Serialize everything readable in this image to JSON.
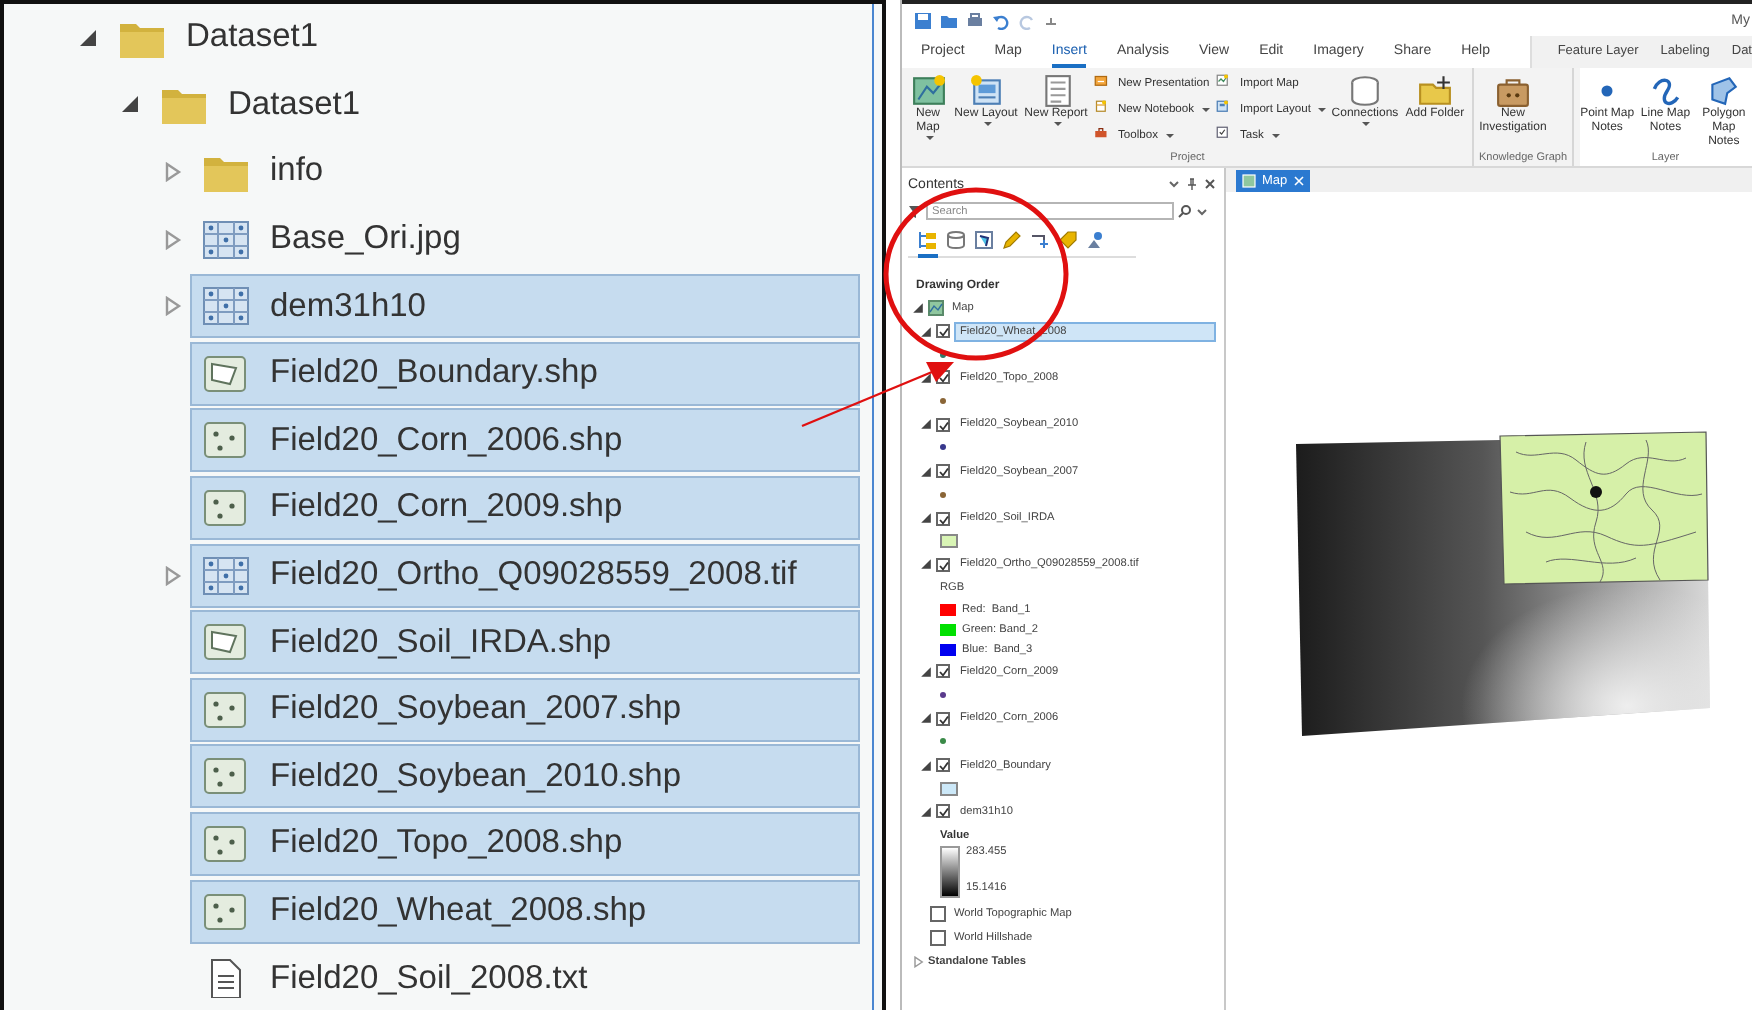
{
  "catalog": {
    "items": [
      {
        "name": "Dataset1",
        "kind": "folder",
        "expandable": true,
        "expanded": true,
        "selected": false,
        "children": [
          {
            "name": "Dataset1",
            "kind": "folder",
            "expandable": true,
            "expanded": true,
            "selected": false,
            "children": [
              {
                "name": "info",
                "kind": "folder",
                "expandable": true,
                "expanded": false,
                "selected": false
              },
              {
                "name": "Base_Ori.jpg",
                "kind": "raster",
                "expandable": true,
                "expanded": false,
                "selected": false
              },
              {
                "name": "dem31h10",
                "kind": "raster",
                "expandable": true,
                "expanded": false,
                "selected": true
              },
              {
                "name": "Field20_Boundary.shp",
                "kind": "polygon",
                "expandable": false,
                "expanded": false,
                "selected": true
              },
              {
                "name": "Field20_Corn_2006.shp",
                "kind": "point",
                "expandable": false,
                "expanded": false,
                "selected": true
              },
              {
                "name": "Field20_Corn_2009.shp",
                "kind": "point",
                "expandable": false,
                "expanded": false,
                "selected": true
              },
              {
                "name": "Field20_Ortho_Q09028559_2008.tif",
                "kind": "raster",
                "expandable": true,
                "expanded": false,
                "selected": true
              },
              {
                "name": "Field20_Soil_IRDA.shp",
                "kind": "polygon",
                "expandable": false,
                "expanded": false,
                "selected": true
              },
              {
                "name": "Field20_Soybean_2007.shp",
                "kind": "point",
                "expandable": false,
                "expanded": false,
                "selected": true
              },
              {
                "name": "Field20_Soybean_2010.shp",
                "kind": "point",
                "expandable": false,
                "expanded": false,
                "selected": true
              },
              {
                "name": "Field20_Topo_2008.shp",
                "kind": "point",
                "expandable": false,
                "expanded": false,
                "selected": true
              },
              {
                "name": "Field20_Wheat_2008.shp",
                "kind": "point",
                "expandable": false,
                "expanded": false,
                "selected": true
              },
              {
                "name": "Field20_Soil_2008.txt",
                "kind": "text",
                "expandable": false,
                "expanded": false,
                "selected": false
              }
            ]
          }
        ]
      }
    ]
  },
  "app": {
    "title_fragment": "My",
    "ribbon": {
      "tabs": [
        {
          "label": "Project",
          "selected": false
        },
        {
          "label": "Map",
          "selected": false
        },
        {
          "label": "Insert",
          "selected": true
        },
        {
          "label": "Analysis",
          "selected": false
        },
        {
          "label": "View",
          "selected": false
        },
        {
          "label": "Edit",
          "selected": false
        },
        {
          "label": "Imagery",
          "selected": false
        },
        {
          "label": "Share",
          "selected": false
        },
        {
          "label": "Help",
          "selected": false
        }
      ],
      "contextual_tabs": [
        {
          "label": "Feature Layer",
          "selected": false
        },
        {
          "label": "Labeling",
          "selected": false
        },
        {
          "label": "Dat",
          "selected": false
        }
      ],
      "groups": [
        {
          "label": "Project",
          "contextual": false,
          "items": [
            {
              "kind": "large",
              "label": "New Map",
              "dropdown": true
            },
            {
              "kind": "large",
              "label": "New Layout",
              "dropdown": true
            },
            {
              "kind": "large",
              "label": "New Report",
              "dropdown": true
            },
            {
              "kind": "stack",
              "buttons": [
                {
                  "label": "New Presentation",
                  "dropdown": false
                },
                {
                  "label": "New Notebook",
                  "dropdown": true
                },
                {
                  "label": "Toolbox",
                  "dropdown": true
                }
              ]
            },
            {
              "kind": "stack",
              "buttons": [
                {
                  "label": "Import Map",
                  "dropdown": false
                },
                {
                  "label": "Import Layout",
                  "dropdown": true
                },
                {
                  "label": "Task",
                  "dropdown": true
                }
              ]
            },
            {
              "kind": "large",
              "label": "Connections",
              "dropdown": true
            },
            {
              "kind": "large",
              "label": "Add Folder",
              "dropdown": false
            }
          ]
        },
        {
          "label": "Knowledge Graph",
          "contextual": false,
          "items": [
            {
              "kind": "large",
              "label": "New Investigation",
              "dropdown": false
            }
          ]
        },
        {
          "label": "Layer",
          "contextual": true,
          "items": [
            {
              "kind": "large",
              "label": "Point Map Notes",
              "dropdown": false
            },
            {
              "kind": "large",
              "label": "Line Map Notes",
              "dropdown": false
            },
            {
              "kind": "large",
              "label": "Polygon Map Notes",
              "dropdown": false
            }
          ]
        }
      ]
    },
    "contents": {
      "title": "Contents",
      "search": {
        "placeholder": "Search"
      },
      "view_tabs": [
        {
          "kind": "drawing-order",
          "selected": true
        },
        {
          "kind": "data-source",
          "selected": false
        },
        {
          "kind": "selection",
          "selected": false
        },
        {
          "kind": "editing",
          "selected": false
        },
        {
          "kind": "snapping",
          "selected": false
        },
        {
          "kind": "labeling",
          "selected": false
        },
        {
          "kind": "perspective",
          "selected": false
        }
      ],
      "heading": "Drawing Order",
      "map": {
        "name": "Map",
        "expanded": true,
        "layers": [
          {
            "name": "Field20_Wheat_2008",
            "checked": true,
            "selected": true,
            "expanded": true,
            "legend": {
              "kind": "point",
              "color": "#2f7a6a"
            }
          },
          {
            "name": "Field20_Topo_2008",
            "checked": true,
            "selected": false,
            "expanded": true,
            "legend": {
              "kind": "point",
              "color": "#8a6536"
            }
          },
          {
            "name": "Field20_Soybean_2010",
            "checked": true,
            "selected": false,
            "expanded": true,
            "legend": {
              "kind": "point",
              "color": "#38388c"
            }
          },
          {
            "name": "Field20_Soybean_2007",
            "checked": true,
            "selected": false,
            "expanded": true,
            "legend": {
              "kind": "point",
              "color": "#8a6536"
            }
          },
          {
            "name": "Field20_Soil_IRDA",
            "checked": true,
            "selected": false,
            "expanded": true,
            "legend": {
              "kind": "polygon",
              "color": "#d9f5b5"
            }
          },
          {
            "name": "Field20_Ortho_Q09028559_2008.tif",
            "checked": true,
            "selected": false,
            "expanded": true,
            "legend": {
              "kind": "rgb",
              "heading": "RGB",
              "bands": [
                {
                  "label": "Red:  Band_1",
                  "color": "#ff0000"
                },
                {
                  "label": "Green: Band_2",
                  "color": "#00e000"
                },
                {
                  "label": "Blue:  Band_3",
                  "color": "#0000f0"
                }
              ]
            }
          },
          {
            "name": "Field20_Corn_2009",
            "checked": true,
            "selected": false,
            "expanded": true,
            "legend": {
              "kind": "point",
              "color": "#5a3a8c"
            }
          },
          {
            "name": "Field20_Corn_2006",
            "checked": true,
            "selected": false,
            "expanded": true,
            "legend": {
              "kind": "point",
              "color": "#3a8a48"
            }
          },
          {
            "name": "Field20_Boundary",
            "checked": true,
            "selected": false,
            "expanded": true,
            "legend": {
              "kind": "polygon",
              "color": "#cce8f8"
            }
          },
          {
            "name": "dem31h10",
            "checked": true,
            "selected": false,
            "expanded": true,
            "legend": {
              "kind": "stretch",
              "heading": "Value",
              "high": "283.455",
              "low": "15.1416"
            }
          }
        ],
        "basemaps": [
          {
            "name": "World Topographic Map",
            "checked": false
          },
          {
            "name": "World Hillshade",
            "checked": false
          }
        ]
      },
      "standalone_tables": {
        "label": "Standalone Tables",
        "expanded": false
      }
    },
    "map_view": {
      "tab": {
        "label": "Map",
        "selected": true
      }
    }
  }
}
